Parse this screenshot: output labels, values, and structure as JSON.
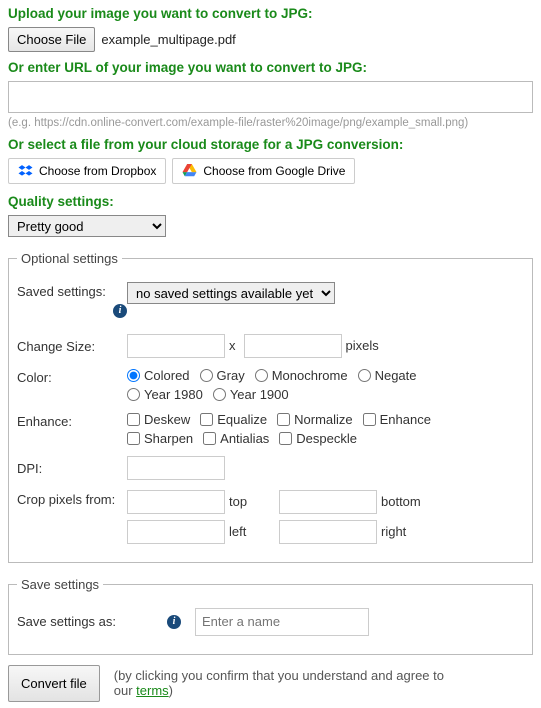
{
  "upload": {
    "heading": "Upload your image you want to convert to JPG:",
    "choose_label": "Choose File",
    "file_name": "example_multipage.pdf"
  },
  "url": {
    "heading": "Or enter URL of your image you want to convert to JPG:",
    "value": "",
    "hint": "(e.g. https://cdn.online-convert.com/example-file/raster%20image/png/example_small.png)"
  },
  "cloud": {
    "heading": "Or select a file from your cloud storage for a JPG conversion:",
    "dropbox_label": "Choose from Dropbox",
    "gdrive_label": "Choose from Google Drive"
  },
  "quality": {
    "heading": "Quality settings:",
    "selected": "Pretty good"
  },
  "optional": {
    "legend": "Optional settings",
    "saved_settings": {
      "label": "Saved settings:",
      "selected": "no saved settings available yet"
    },
    "change_size": {
      "label": "Change Size:",
      "width": "",
      "height": "",
      "sep": "x",
      "unit": "pixels"
    },
    "color": {
      "label": "Color:",
      "options": [
        "Colored",
        "Gray",
        "Monochrome",
        "Negate",
        "Year 1980",
        "Year 1900"
      ],
      "selected": "Colored"
    },
    "enhance": {
      "label": "Enhance:",
      "options": [
        "Deskew",
        "Equalize",
        "Normalize",
        "Enhance",
        "Sharpen",
        "Antialias",
        "Despeckle"
      ]
    },
    "dpi": {
      "label": "DPI:",
      "value": ""
    },
    "crop": {
      "label": "Crop pixels from:",
      "top": "",
      "bottom": "",
      "left": "",
      "right": "",
      "top_lbl": "top",
      "bottom_lbl": "bottom",
      "left_lbl": "left",
      "right_lbl": "right"
    }
  },
  "save": {
    "legend": "Save settings",
    "label": "Save settings as:",
    "placeholder": "Enter a name"
  },
  "footer": {
    "convert_label": "Convert file",
    "disclaimer_pre": "(by clicking you confirm that you understand and agree to our ",
    "terms_label": "terms",
    "disclaimer_post": ")"
  }
}
